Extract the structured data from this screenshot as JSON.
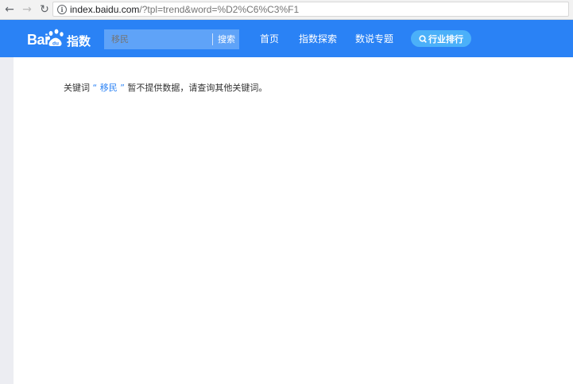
{
  "browser": {
    "url_host": "index.baidu.com",
    "url_rest": "/?tpl=trend&word=%D2%C6%C3%F1"
  },
  "header": {
    "logo_text_latin": "Bai",
    "logo_text_du": "du",
    "logo_text_cn": "指数",
    "search_placeholder": "移民",
    "search_button": "搜索",
    "nav": {
      "home": "首页",
      "explore": "指数探索",
      "topics": "数说专题"
    },
    "rank_button": "行业排行",
    "colors": {
      "header_bg": "#2a82f5",
      "search_bg": "#5fa3f8",
      "rank_bg": "#4bb0f9"
    }
  },
  "main": {
    "prefix": "关键词",
    "open_quote": "“",
    "keyword": "移民",
    "close_quote": "”",
    "suffix": "暂不提供数据，请查询其他关键词。"
  }
}
